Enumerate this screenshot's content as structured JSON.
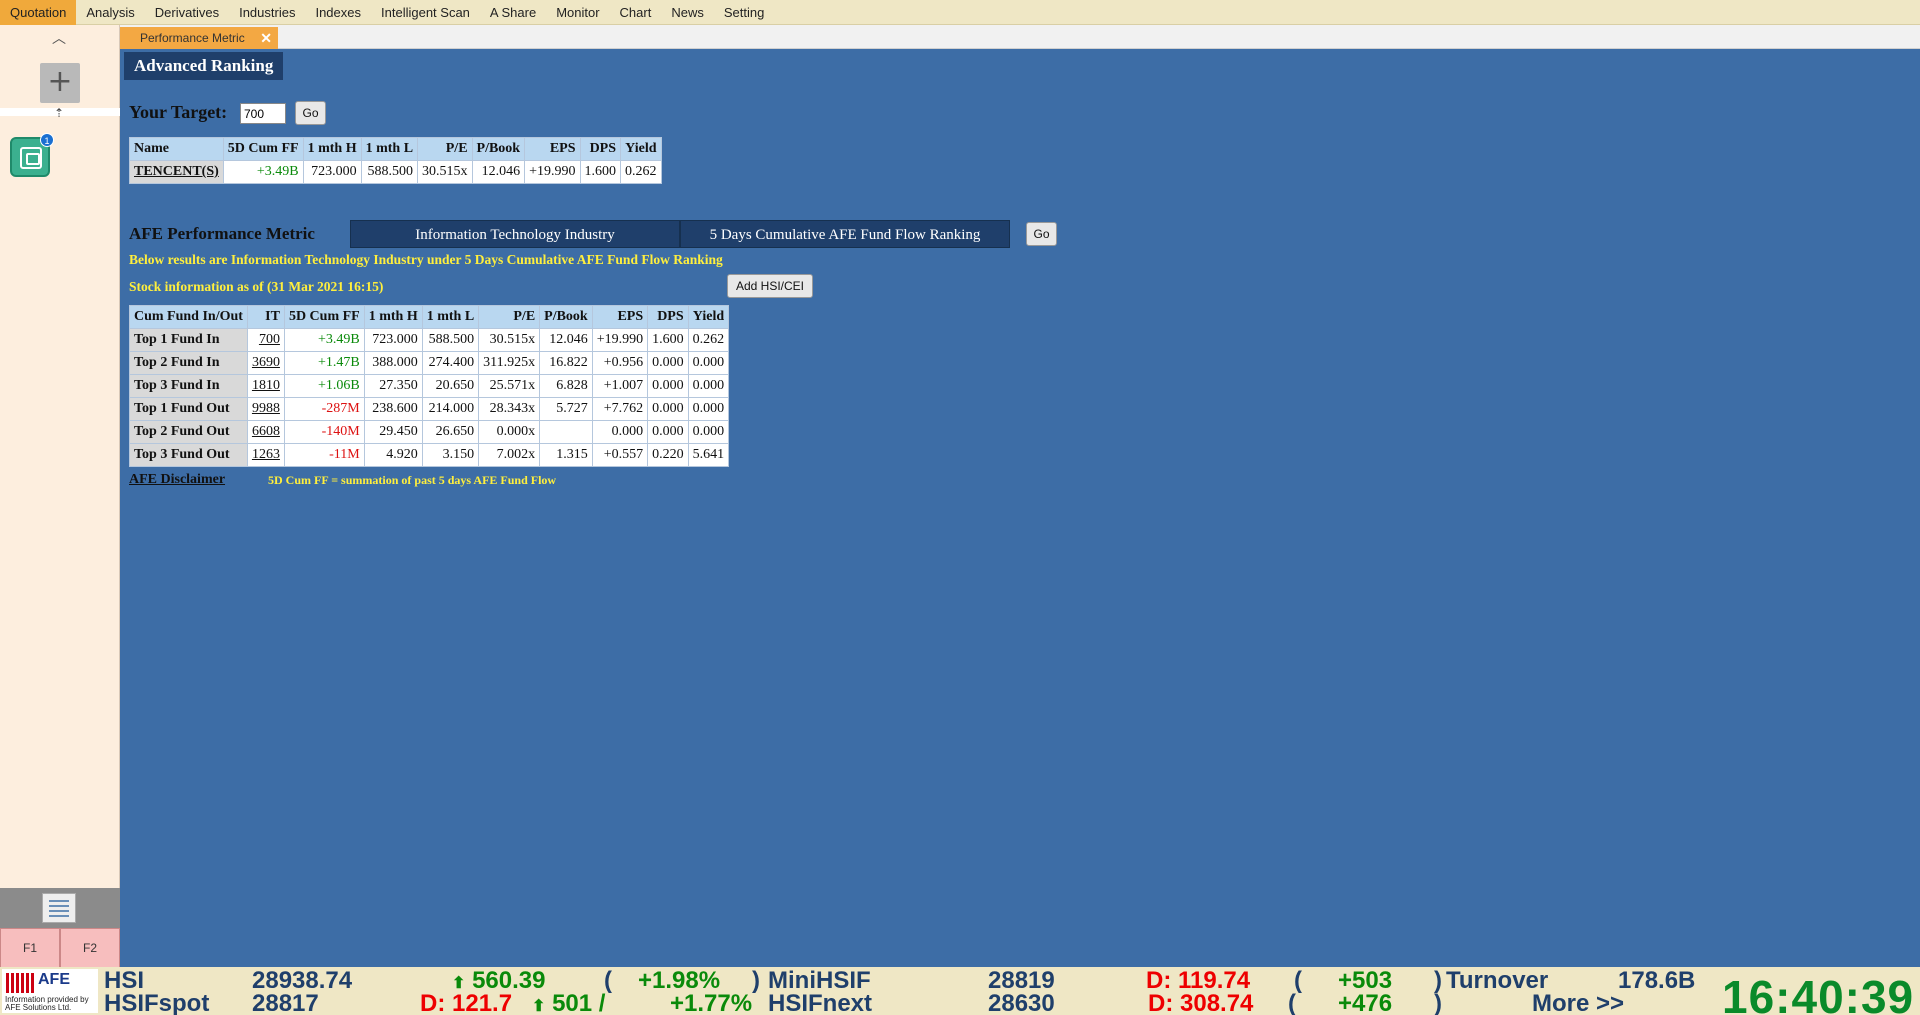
{
  "menu": {
    "items": [
      "Quotation",
      "Analysis",
      "Derivatives",
      "Industries",
      "Indexes",
      "Intelligent Scan",
      "A Share",
      "Monitor",
      "Chart",
      "News",
      "Setting"
    ],
    "active": "Quotation"
  },
  "sidebar": {
    "add_label": "+",
    "window_count": "1",
    "f1_label": "F1",
    "f2_label": "F2"
  },
  "tab": {
    "label": "Performance Metric",
    "close": "✕"
  },
  "page": {
    "title": "Advanced Ranking",
    "target_label": "Your Target:",
    "target_value": "700",
    "go_label": "Go"
  },
  "target_table": {
    "headers": [
      "Name",
      "5D Cum FF",
      "1 mth H",
      "1 mth L",
      "P/E",
      "P/Book",
      "EPS",
      "DPS",
      "Yield"
    ],
    "row": [
      "TENCENT(S)",
      "+3.49B",
      "723.000",
      "588.500",
      "30.515x",
      "12.046",
      "+19.990",
      "1.600",
      "0.262"
    ]
  },
  "afe": {
    "title": "AFE Performance Metric",
    "industry": "Information Technology Industry",
    "ranking": "5 Days Cumulative AFE Fund Flow Ranking",
    "go_label": "Go",
    "results_caption": "Below results are Information Technology Industry under 5 Days Cumulative AFE Fund Flow Ranking",
    "stock_info_caption": "Stock information as of (31 Mar 2021 16:15)",
    "add_button": "Add HSI/CEI",
    "disclaimer": "AFE Disclaimer",
    "footnote": "5D Cum FF = summation of past 5 days AFE Fund Flow"
  },
  "ranking_table": {
    "headers": [
      "Cum Fund In/Out",
      "IT",
      "5D Cum FF",
      "1 mth H",
      "1 mth L",
      "P/E",
      "P/Book",
      "EPS",
      "DPS",
      "Yield"
    ],
    "rows": [
      [
        "Top 1 Fund In",
        "700",
        "+3.49B",
        "723.000",
        "588.500",
        "30.515x",
        "12.046",
        "+19.990",
        "1.600",
        "0.262"
      ],
      [
        "Top 2 Fund In",
        "3690",
        "+1.47B",
        "388.000",
        "274.400",
        "311.925x",
        "16.822",
        "+0.956",
        "0.000",
        "0.000"
      ],
      [
        "Top 3 Fund In",
        "1810",
        "+1.06B",
        "27.350",
        "20.650",
        "25.571x",
        "6.828",
        "+1.007",
        "0.000",
        "0.000"
      ],
      [
        "Top 1 Fund Out",
        "9988",
        "-287M",
        "238.600",
        "214.000",
        "28.343x",
        "5.727",
        "+7.762",
        "0.000",
        "0.000"
      ],
      [
        "Top 2 Fund Out",
        "6608",
        "-140M",
        "29.450",
        "26.650",
        "0.000x",
        "",
        "0.000",
        "0.000",
        "0.000"
      ],
      [
        "Top 3 Fund Out",
        "1263",
        "-11M",
        "4.920",
        "3.150",
        "7.002x",
        "1.315",
        "+0.557",
        "0.220",
        "5.641"
      ]
    ]
  },
  "ticker": {
    "logo": "AFE",
    "credit": "Information provided by AFE Solutions Ltd.",
    "hsi_label": "HSI",
    "hsi_value": "28938.74",
    "hsi_change": "560.39",
    "hsi_open": "(",
    "hsi_pct": "+1.98%",
    "hsi_close": ")",
    "minihsif_label": "MiniHSIF",
    "minihsif_value": "28819",
    "minihsif_d": "D: 119.74",
    "minihsif_open": "(",
    "minihsif_chg": "+503",
    "minihsif_close": ")",
    "turnover_label": "Turnover",
    "turnover_value": "178.6B",
    "hsifspot_label": "HSIFspot",
    "hsifspot_value": "28817",
    "hsifspot_d": "D: 121.7",
    "hsifspot_change": "501 /",
    "hsifspot_pct": "+1.77%",
    "hsifnext_label": "HSIFnext",
    "hsifnext_value": "28630",
    "hsifnext_d": "D: 308.74",
    "hsifnext_open": "(",
    "hsifnext_chg": "+476",
    "hsifnext_close": ")",
    "more_label": "More >>",
    "clock": "16:40:39"
  }
}
